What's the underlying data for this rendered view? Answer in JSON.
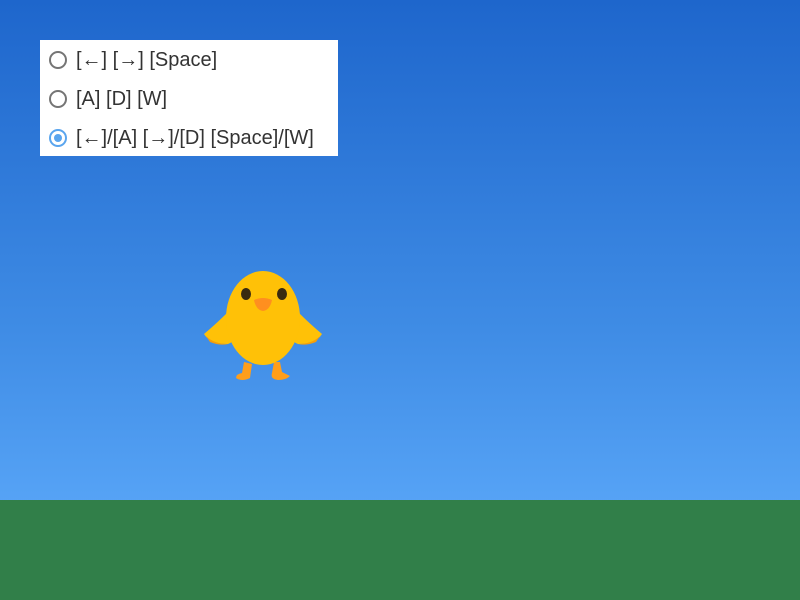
{
  "controls": {
    "options": [
      {
        "label": "[←] [→] [Space]",
        "selected": false
      },
      {
        "label": "[A] [D] [W]",
        "selected": false
      },
      {
        "label": "[←]/[A] [→]/[D] [Space]/[W]",
        "selected": true
      }
    ],
    "accent_color": "#5aa5ee"
  },
  "scene": {
    "sky_top_color": "#1e66cc",
    "sky_bottom_color": "#63b0ff",
    "ground_color": "#317f49",
    "player": "chick"
  }
}
